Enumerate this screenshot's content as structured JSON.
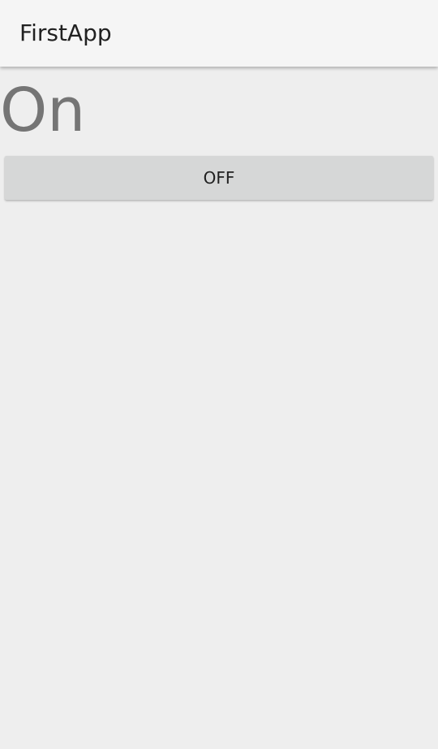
{
  "app": {
    "title": "FirstApp"
  },
  "main": {
    "status": "On",
    "toggle_button_label": "OFF"
  },
  "colors": {
    "background": "#eeeeee",
    "app_bar": "#f5f5f5",
    "title_text": "#212121",
    "status_text": "#757575",
    "button_background": "#d6d7d7"
  }
}
